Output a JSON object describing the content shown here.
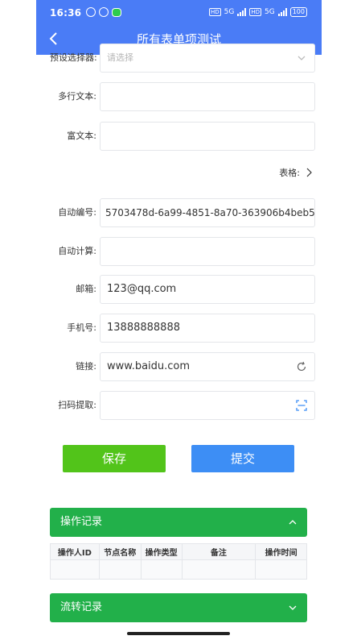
{
  "status_bar": {
    "time": "16:36",
    "network_left": "5G",
    "network_right": "5G",
    "battery": "100"
  },
  "nav": {
    "title": "所有表单项测试"
  },
  "form": {
    "preset_select": {
      "label": "预设选择器:",
      "placeholder": "请选择"
    },
    "multiline_text": {
      "label": "多行文本:",
      "value": ""
    },
    "rich_text": {
      "label": "富文本:",
      "value": ""
    },
    "table_link": {
      "label": "表格:"
    },
    "auto_number": {
      "label": "自动编号:",
      "value": "5703478d-6a99-4851-8a70-363906b4beb5"
    },
    "auto_calc": {
      "label": "自动计算:",
      "value": ""
    },
    "email": {
      "label": "邮箱:",
      "value": "123@qq.com"
    },
    "phone": {
      "label": "手机号:",
      "value": "13888888888"
    },
    "link": {
      "label": "链接:",
      "value": "www.baidu.com"
    },
    "scan": {
      "label": "扫码提取:",
      "value": ""
    }
  },
  "buttons": {
    "save": "保存",
    "submit": "提交"
  },
  "operation_log": {
    "title": "操作记录",
    "columns": [
      "操作人ID",
      "节点名称",
      "操作类型",
      "备注",
      "操作时间"
    ]
  },
  "flow_log": {
    "title": "流转记录"
  },
  "colors": {
    "header": "#4a7cf6",
    "save": "#52c41a",
    "submit": "#3d8ef5",
    "panel": "#22b04a"
  }
}
